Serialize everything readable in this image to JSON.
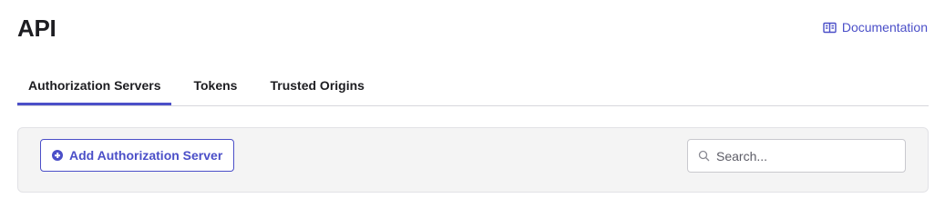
{
  "page": {
    "title": "API"
  },
  "header": {
    "documentation_label": "Documentation",
    "documentation_icon": "book-icon"
  },
  "tabs": [
    {
      "label": "Authorization Servers",
      "active": true
    },
    {
      "label": "Tokens",
      "active": false
    },
    {
      "label": "Trusted Origins",
      "active": false
    }
  ],
  "toolbar": {
    "add_button_label": "Add Authorization Server",
    "add_button_icon": "plus-circle-icon",
    "search_placeholder": "Search...",
    "search_value": "",
    "search_icon": "search-icon"
  },
  "colors": {
    "accent": "#4b4fc8",
    "text": "#1d1d21",
    "panel_bg": "#f4f4f4",
    "divider": "#d7d7dc"
  }
}
